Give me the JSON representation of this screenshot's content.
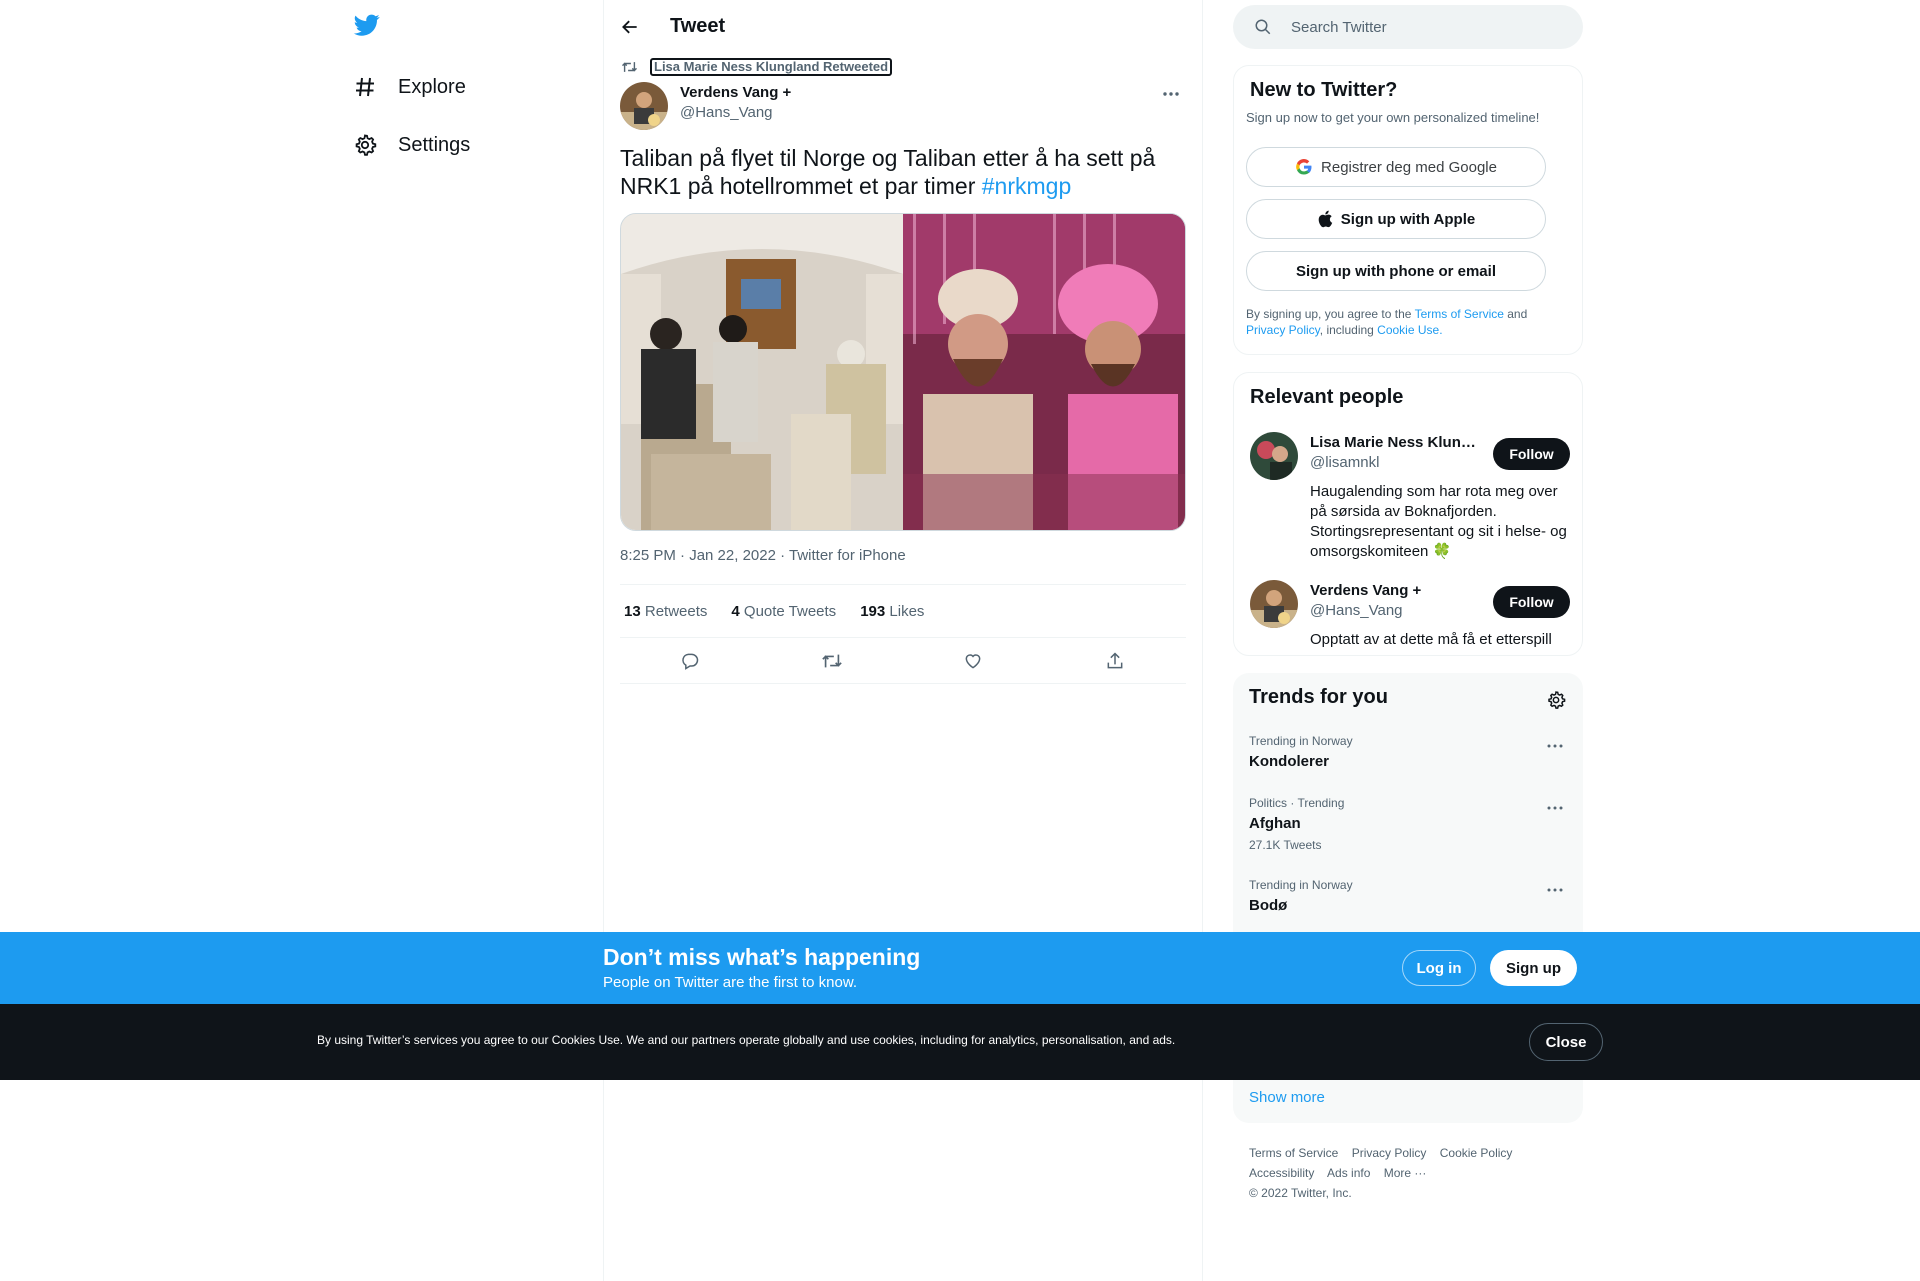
{
  "nav": {
    "items": [
      {
        "label": "Explore",
        "icon": "hashtag-icon"
      },
      {
        "label": "Settings",
        "icon": "gear-icon"
      }
    ]
  },
  "header": {
    "title": "Tweet"
  },
  "tweet": {
    "retweeted_by": "Lisa Marie Ness Klungland Retweeted",
    "author_name": "Verdens Vang +",
    "author_handle": "@Hans_Vang",
    "text": "Taliban på flyet til Norge og Taliban etter å ha sett på NRK1 på hotellrommet et par timer ",
    "hashtag": "#nrkmgp",
    "meta": "8:25 PM · Jan 22, 2022 · Twitter for iPhone",
    "stats": {
      "retweets": "13",
      "retweets_label": "Retweets",
      "quotes": "4",
      "quotes_label": "Quote Tweets",
      "likes": "193",
      "likes_label": "Likes"
    }
  },
  "search": {
    "placeholder": "Search Twitter"
  },
  "signup_card": {
    "title": "New to Twitter?",
    "subtitle": "Sign up now to get your own personalized timeline!",
    "google": "Registrer deg med Google",
    "apple": "Sign up with Apple",
    "phone": "Sign up with phone or email",
    "legal_1": "By signing up, you agree to the ",
    "tos": "Terms of Service",
    "legal_2": " and ",
    "privacy": "Privacy Policy",
    "legal_3": ", including ",
    "cookie": "Cookie Use."
  },
  "people": {
    "title": "Relevant people",
    "list": [
      {
        "name": "Lisa Marie Ness Klungland",
        "handle": "@lisamnkl",
        "bio": "Haugalending som har rota meg over på sørsida av Boknafjorden. Stortingsrepresentant og sit i helse- og omsorgskomiteen 🍀",
        "follow": "Follow"
      },
      {
        "name": "Verdens Vang +",
        "handle": "@Hans_Vang",
        "bio": "Opptatt av at dette må få et etterspill",
        "follow": "Follow"
      }
    ]
  },
  "trends": {
    "title": "Trends for you",
    "items": [
      {
        "context": "Trending in Norway",
        "name": "Kondolerer",
        "count": ""
      },
      {
        "context": "Politics · Trending",
        "name": "Afghan",
        "count": "27.1K Tweets"
      },
      {
        "context": "Trending in Norway",
        "name": "Bodø",
        "count": ""
      }
    ],
    "show_more": "Show more"
  },
  "footer": {
    "row1": [
      "Terms of Service",
      "Privacy Policy",
      "Cookie Policy"
    ],
    "row2": [
      "Accessibility",
      "Ads info",
      "More ···"
    ],
    "copyright": "© 2022 Twitter, Inc."
  },
  "banner": {
    "title": "Don’t miss what’s happening",
    "subtitle": "People on Twitter are the first to know.",
    "login": "Log in",
    "signup": "Sign up"
  },
  "cookie_bar": {
    "text": "By using Twitter’s services you agree to our Cookies Use. We and our partners operate globally and use cookies, including for analytics, personalisation, and ads.",
    "close": "Close"
  },
  "colors": {
    "accent": "#1d9bf0",
    "text": "#0f1419",
    "muted": "#536471",
    "dark": "#0f1419"
  }
}
